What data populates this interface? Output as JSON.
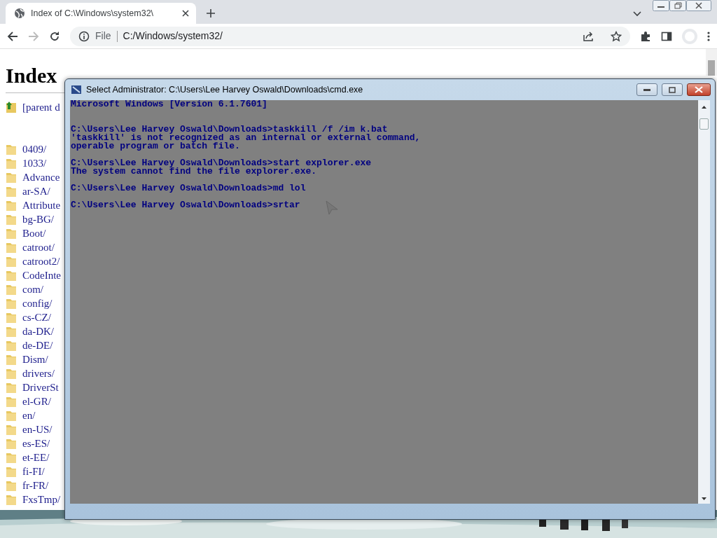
{
  "browser": {
    "tab": {
      "title": "Index of C:\\Windows\\system32\\",
      "selected": true
    },
    "address": {
      "scheme": "File",
      "url": "C:/Windows/system32/"
    },
    "nav": {
      "back_disabled": false,
      "forward_disabled": true
    }
  },
  "page": {
    "heading": "Index",
    "parent_link": "[parent d",
    "entries": [
      "0409/",
      "1033/",
      "Advance",
      "ar-SA/",
      "Attribute",
      "bg-BG/",
      "Boot/",
      "catroot/",
      "catroot2/",
      "CodeInte",
      "com/",
      "config/",
      "cs-CZ/",
      "da-DK/",
      "de-DE/",
      "Dism/",
      "drivers/",
      "DriverSt",
      "el-GR/",
      "en/",
      "en-US/",
      "es-ES/",
      "et-EE/",
      "fi-FI/",
      "fr-FR/",
      "FxsTmp/"
    ]
  },
  "console": {
    "title": "Select Administrator: C:\\Users\\Lee Harvey Oswald\\Downloads\\cmd.exe",
    "output": "Microsoft Windows [Version 6.1.7601]\n\n\nC:\\Users\\Lee Harvey Oswald\\Downloads>taskkill /f /im k.bat\n'taskkill' is not recognized as an internal or external command,\noperable program or batch file.\n\nC:\\Users\\Lee Harvey Oswald\\Downloads>start explorer.exe\nThe system cannot find the file explorer.exe.\n\nC:\\Users\\Lee Harvey Oswald\\Downloads>md lol\n\nC:\\Users\\Lee Harvey Oswald\\Downloads>srtar"
  }
}
